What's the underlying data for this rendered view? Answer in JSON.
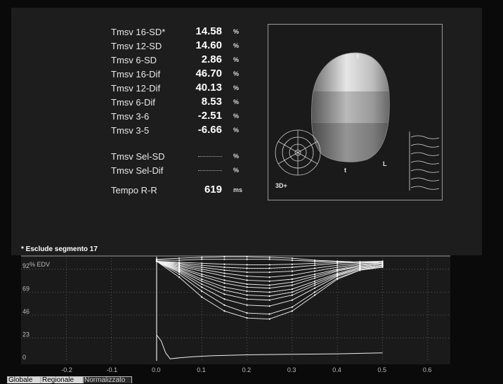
{
  "metrics": [
    {
      "label": "Tmsv 16-SD*",
      "value": "14.58",
      "unit": "%"
    },
    {
      "label": "Tmsv 12-SD",
      "value": "14.60",
      "unit": "%"
    },
    {
      "label": "Tmsv 6-SD",
      "value": "2.86",
      "unit": "%"
    },
    {
      "label": "Tmsv 16-Dif",
      "value": "46.70",
      "unit": "%"
    },
    {
      "label": "Tmsv 12-Dif",
      "value": "40.13",
      "unit": "%"
    },
    {
      "label": "Tmsv 6-Dif",
      "value": "8.53",
      "unit": "%"
    },
    {
      "label": "Tmsv 3-6",
      "value": "-2.51",
      "unit": "%"
    },
    {
      "label": "Tmsv 3-5",
      "value": "-6.66",
      "unit": "%"
    }
  ],
  "selected_metrics": [
    {
      "label": "Tmsv Sel-SD",
      "value": "",
      "unit": "%"
    },
    {
      "label": "Tmsv Sel-Dif",
      "value": "",
      "unit": "%"
    }
  ],
  "rr_interval": {
    "label": "Tempo R-R",
    "value": "619",
    "unit": "ms"
  },
  "viewer": {
    "badge": "3D+",
    "marker_l": "L",
    "marker_t": "t"
  },
  "footnote": "* Esclude segmento 17",
  "tabs": [
    {
      "label": "Globale",
      "active": true
    },
    {
      "label": "Regionale",
      "active": true
    },
    {
      "label": "Normalizzato",
      "active": false
    }
  ],
  "colors": {
    "background": "#0a0a0a",
    "panel": "#1d1d1d",
    "curve": "#ffffff",
    "grid": "#6a6a6a"
  },
  "chart_data": {
    "type": "line",
    "ylabel": "% EDV",
    "xlim": [
      -0.3,
      0.65
    ],
    "ylim": [
      0,
      106
    ],
    "yticks": [
      0,
      23,
      46,
      69,
      92
    ],
    "xticks": [
      -0.2,
      -0.1,
      0.0,
      0.1,
      0.2,
      0.3,
      0.4,
      0.5,
      0.6
    ],
    "xtick_labels": [
      "-0.2",
      "-0.1",
      "0.0",
      "0.1",
      "0.2",
      "0.3",
      "0.4",
      "0.5",
      "0.6"
    ],
    "grid": true,
    "marker_x": 0.0,
    "regional_curves": [
      {
        "x": [
          0.0,
          0.05,
          0.1,
          0.15,
          0.2,
          0.25,
          0.3,
          0.35,
          0.4,
          0.45,
          0.5
        ],
        "y": [
          100,
          99,
          98,
          97,
          96.5,
          96.5,
          97,
          98,
          99,
          99.5,
          100
        ]
      },
      {
        "x": [
          0.0,
          0.05,
          0.1,
          0.15,
          0.2,
          0.25,
          0.3,
          0.35,
          0.4,
          0.45,
          0.5
        ],
        "y": [
          100,
          98,
          96,
          94,
          93,
          93,
          94,
          96,
          98,
          99,
          100
        ]
      },
      {
        "x": [
          0.0,
          0.05,
          0.1,
          0.15,
          0.2,
          0.25,
          0.3,
          0.35,
          0.4,
          0.45,
          0.5
        ],
        "y": [
          100,
          97,
          94,
          91,
          89,
          89,
          90,
          93,
          96,
          98,
          99
        ]
      },
      {
        "x": [
          0.0,
          0.05,
          0.1,
          0.15,
          0.2,
          0.25,
          0.3,
          0.35,
          0.4,
          0.45,
          0.5
        ],
        "y": [
          100,
          96,
          92,
          88,
          85,
          84,
          86,
          90,
          94,
          97,
          98
        ]
      },
      {
        "x": [
          0.0,
          0.05,
          0.1,
          0.15,
          0.2,
          0.25,
          0.3,
          0.35,
          0.4,
          0.45,
          0.5
        ],
        "y": [
          100,
          95,
          90,
          85,
          81,
          80,
          82,
          87,
          92,
          96,
          98
        ]
      },
      {
        "x": [
          0.0,
          0.05,
          0.1,
          0.15,
          0.2,
          0.25,
          0.3,
          0.35,
          0.4,
          0.45,
          0.5
        ],
        "y": [
          100,
          94,
          87,
          81,
          77,
          76,
          79,
          85,
          91,
          95,
          97
        ]
      },
      {
        "x": [
          0.0,
          0.05,
          0.1,
          0.15,
          0.2,
          0.25,
          0.3,
          0.35,
          0.4,
          0.45,
          0.5
        ],
        "y": [
          100,
          93,
          85,
          78,
          74,
          73,
          76,
          83,
          90,
          95,
          97
        ]
      },
      {
        "x": [
          0.0,
          0.05,
          0.1,
          0.15,
          0.2,
          0.25,
          0.3,
          0.35,
          0.4,
          0.45,
          0.5
        ],
        "y": [
          100,
          92,
          82,
          74,
          70,
          69,
          72,
          80,
          88,
          94,
          96
        ]
      },
      {
        "x": [
          0.0,
          0.05,
          0.1,
          0.15,
          0.2,
          0.25,
          0.3,
          0.35,
          0.4,
          0.45,
          0.5
        ],
        "y": [
          100,
          91,
          80,
          71,
          66,
          65,
          69,
          78,
          87,
          93,
          96
        ]
      },
      {
        "x": [
          0.0,
          0.05,
          0.1,
          0.15,
          0.2,
          0.25,
          0.3,
          0.35,
          0.4,
          0.45,
          0.5
        ],
        "y": [
          100,
          90,
          77,
          67,
          62,
          61,
          66,
          76,
          86,
          93,
          96
        ]
      },
      {
        "x": [
          0.0,
          0.05,
          0.1,
          0.15,
          0.2,
          0.25,
          0.3,
          0.35,
          0.4,
          0.45,
          0.5
        ],
        "y": [
          100,
          89,
          74,
          62,
          56,
          55,
          61,
          73,
          85,
          92,
          95
        ]
      },
      {
        "x": [
          0.0,
          0.05,
          0.1,
          0.15,
          0.2,
          0.25,
          0.3,
          0.35,
          0.4,
          0.45,
          0.5
        ],
        "y": [
          100,
          87,
          70,
          56,
          48,
          47,
          54,
          69,
          83,
          91,
          95
        ]
      },
      {
        "x": [
          0.0,
          0.05,
          0.1,
          0.15,
          0.2,
          0.25,
          0.3,
          0.35,
          0.4,
          0.45,
          0.5
        ],
        "y": [
          100,
          84,
          64,
          50,
          43,
          42,
          50,
          66,
          82,
          91,
          94
        ]
      },
      {
        "x": [
          0.0,
          0.05,
          0.1,
          0.15,
          0.2,
          0.25,
          0.3,
          0.35,
          0.4,
          0.45,
          0.5
        ],
        "y": [
          101,
          101,
          102,
          102,
          102,
          102,
          101,
          100,
          100,
          99,
          99
        ]
      },
      {
        "x": [
          0.0,
          0.05,
          0.1,
          0.15,
          0.2,
          0.25,
          0.3,
          0.35,
          0.4,
          0.45,
          0.5
        ],
        "y": [
          102,
          103,
          104,
          104.5,
          104.5,
          104,
          103,
          101,
          100,
          99,
          98
        ]
      }
    ],
    "derivative_curve": {
      "x": [
        0.0,
        0.01,
        0.02,
        0.03,
        0.05,
        0.08,
        0.12,
        0.2,
        0.3,
        0.4,
        0.5
      ],
      "y": [
        26,
        20,
        8,
        2,
        3,
        4,
        5,
        6,
        6.5,
        7,
        8
      ]
    }
  }
}
